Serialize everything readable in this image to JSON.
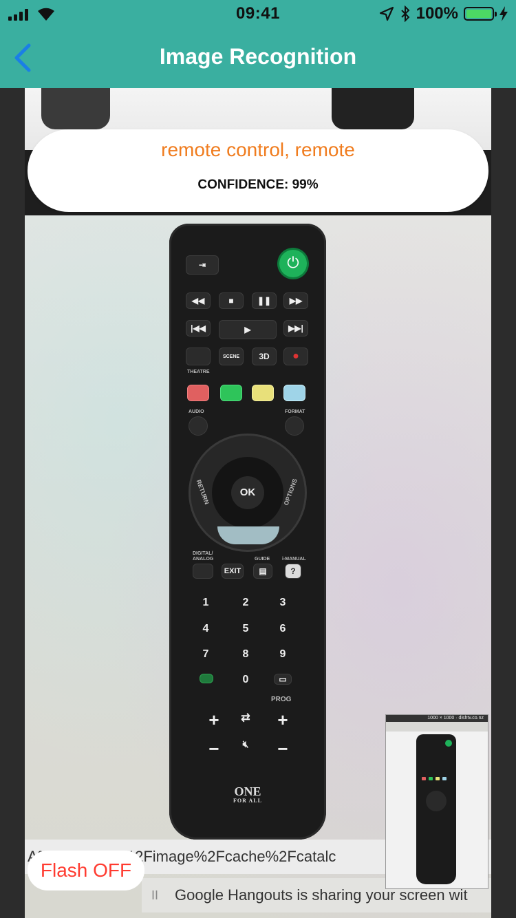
{
  "status_bar": {
    "time": "09:41",
    "battery": "100%",
    "icons": [
      "signal-icon",
      "wifi-icon",
      "location-arrow-icon",
      "bluetooth-icon",
      "battery-icon",
      "charging-bolt-icon"
    ]
  },
  "nav": {
    "title": "Image Recognition",
    "back_icon": "chevron-left-icon"
  },
  "result": {
    "label": "remote control, remote",
    "confidence": "CONFIDENCE: 99%"
  },
  "flash": {
    "label": "Flash OFF"
  },
  "thumbnail": {
    "caption": "1000 × 1000 · dishtv.co.nz"
  },
  "background_text": {
    "url_fragment": "A%… tv.co.nz%2Fimage%2Fcache%2Fcatalc",
    "hangouts_banner": "Google Hangouts is sharing your screen wit"
  },
  "remote": {
    "labels": {
      "theatre": "THEATRE",
      "scene": "SCENE",
      "three_d": "3D",
      "audio": "AUDIO",
      "format": "FORMAT",
      "ok": "OK",
      "return": "RETURN",
      "options": "OPTIONS",
      "digital_analog": "DIGITAL/ ANALOG",
      "exit": "EXIT",
      "guide": "GUIDE",
      "i_manual": "i-MANUAL",
      "prog": "PROG",
      "brand": "ONE",
      "brand_sub": "FOR ALL"
    },
    "digits": [
      "1",
      "2",
      "3",
      "4",
      "5",
      "6",
      "7",
      "8",
      "9",
      "0"
    ]
  },
  "colors": {
    "accent": "#3aafa0",
    "result_label": "#f07c1e",
    "flash_text": "#ff3b30",
    "back_chevron": "#1a7fe6"
  }
}
